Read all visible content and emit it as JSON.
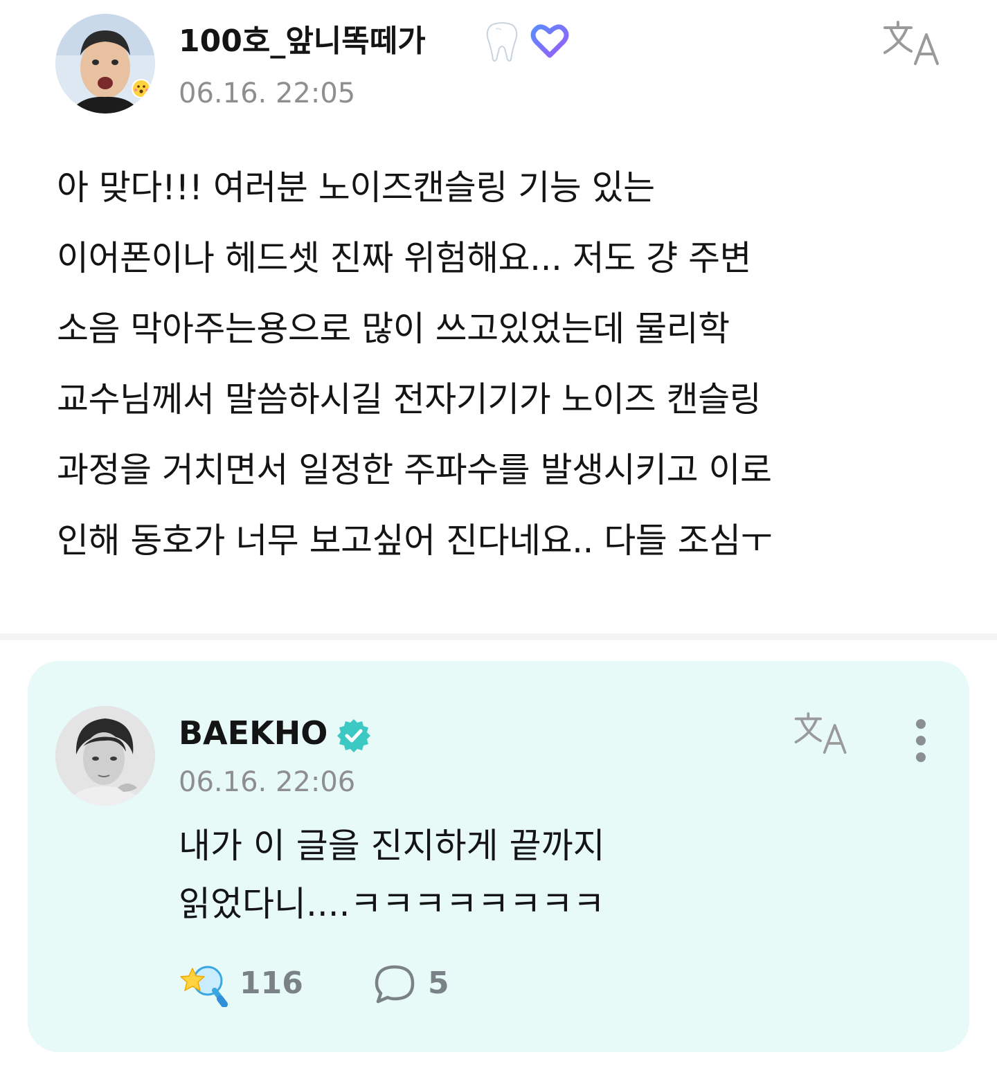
{
  "post": {
    "author_name": "100호_앞니똑떼가",
    "author_badge_emoji": "tooth",
    "author_badge_icon": "heart-badge-icon",
    "timestamp": "06.16. 22:05",
    "translate_icon": "translate-icon",
    "body_lines": [
      "아 맞다!!! 여러분 노이즈캔슬링 기능 있는",
      "이어폰이나 헤드셋 진짜 위험해요... 저도 걍 주변",
      "소음 막아주는용으로 많이 쓰고있었는데 물리학",
      "교수님께서 말씀하시길 전자기기가 노이즈 캔슬링",
      "과정을 거치면서 일정한 주파수를 발생시키고 이로",
      "인해 동호가 너무 보고싶어 진다네요.. 다들 조심ㅜ"
    ]
  },
  "reply": {
    "author_name": "BAEKHO",
    "verified_icon": "verified-badge-icon",
    "timestamp": "06.16. 22:06",
    "translate_icon": "translate-icon",
    "more_icon": "more-vertical-icon",
    "body_lines": [
      "내가 이 글을 진지하게 끝까지",
      "읽었다니....ㅋㅋㅋㅋㅋㅋㅋㅋ"
    ],
    "like_icon": "star-lightstick-icon",
    "like_count": "116",
    "comment_icon": "speech-bubble-icon",
    "comment_count": "5"
  },
  "colors": {
    "reply_background": "#e7faf7",
    "verified_teal": "#3cc9c4",
    "heart_blue": "#4a6cf7",
    "heart_purple": "#8b5cf6",
    "muted_gray": "#8e8e8e"
  }
}
